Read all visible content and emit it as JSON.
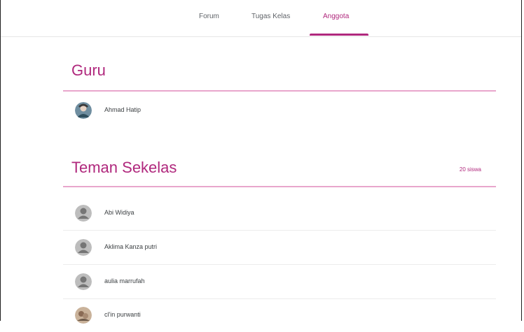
{
  "tabs": [
    {
      "label": "Forum",
      "active": false
    },
    {
      "label": "Tugas Kelas",
      "active": false
    },
    {
      "label": "Anggota",
      "active": true
    }
  ],
  "teachers": {
    "title": "Guru",
    "members": [
      {
        "name": "Ahmad Hatip",
        "avatar": "photo-avatar"
      }
    ]
  },
  "classmates": {
    "title": "Teman Sekelas",
    "count": "20 siswa",
    "members": [
      {
        "name": "Abi Widiya",
        "avatar": "default-avatar"
      },
      {
        "name": "Aklima Kanza putri",
        "avatar": "default-avatar"
      },
      {
        "name": "aulia marrufah",
        "avatar": "default-avatar"
      },
      {
        "name": "cl'in purwanti",
        "avatar": "photo-avatar"
      }
    ]
  },
  "colors": {
    "accent": "#b0287d",
    "divider": "#e8a6cc"
  }
}
